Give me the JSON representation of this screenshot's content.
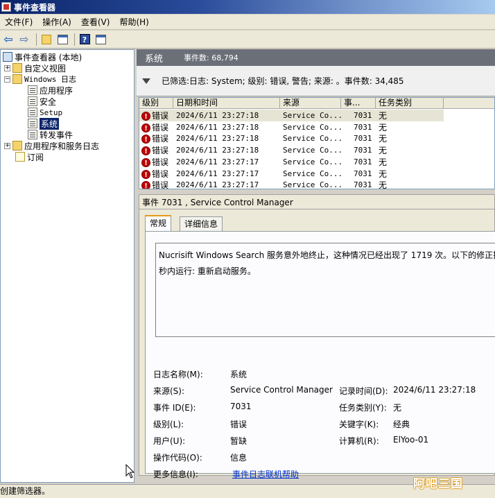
{
  "window": {
    "title": "事件查看器"
  },
  "menu": [
    "文件(F)",
    "操作(A)",
    "查看(V)",
    "帮助(H)"
  ],
  "tree": {
    "root": "事件查看器 (本地)",
    "custom_views": "自定义视图",
    "windows_logs": "Windows 日志",
    "logs": [
      "应用程序",
      "安全",
      "Setup",
      "系统",
      "转发事件"
    ],
    "app_service_logs": "应用程序和服务日志",
    "subscriptions": "订阅"
  },
  "header": {
    "title": "系统",
    "count": "事件数: 68,794"
  },
  "filter": {
    "text": "已筛选:日志: System; 级别: 错误, 警告; 来源: 。事件数: 34,485"
  },
  "table": {
    "columns": [
      "级别",
      "日期和时间",
      "来源",
      "事...",
      "任务类别"
    ],
    "rows": [
      {
        "level": "错误",
        "datetime": "2024/6/11 23:27:18",
        "source": "Service Co...",
        "id": "7031",
        "category": "无"
      },
      {
        "level": "错误",
        "datetime": "2024/6/11 23:27:18",
        "source": "Service Co...",
        "id": "7031",
        "category": "无"
      },
      {
        "level": "错误",
        "datetime": "2024/6/11 23:27:18",
        "source": "Service Co...",
        "id": "7031",
        "category": "无"
      },
      {
        "level": "错误",
        "datetime": "2024/6/11 23:27:18",
        "source": "Service Co...",
        "id": "7031",
        "category": "无"
      },
      {
        "level": "错误",
        "datetime": "2024/6/11 23:27:17",
        "source": "Service Co...",
        "id": "7031",
        "category": "无"
      },
      {
        "level": "错误",
        "datetime": "2024/6/11 23:27:17",
        "source": "Service Co...",
        "id": "7031",
        "category": "无"
      },
      {
        "level": "错误",
        "datetime": "2024/6/11 23:27:17",
        "source": "Service Co...",
        "id": "7031",
        "category": "无"
      }
    ]
  },
  "detail": {
    "title": "事件 7031 , Service Control Manager",
    "tabs": [
      "常规",
      "详细信息"
    ],
    "description_line1": "Nucrisift Windows Search 服务意外地终止，这种情况已经出现了 1719 次。以下的修正操作",
    "description_line2": "秒内运行: 重新启动服务。",
    "labels": {
      "log_name": "日志名称(M):",
      "source": "来源(S):",
      "event_id": "事件 ID(E):",
      "level": "级别(L):",
      "user": "用户(U):",
      "opcode": "操作代码(O):",
      "more_info": "更多信息(I):",
      "logged": "记录时间(D):",
      "task_category": "任务类别(Y):",
      "keywords": "关键字(K):",
      "computer": "计算机(R):"
    },
    "values": {
      "log_name": "系统",
      "source": "Service Control Manager",
      "event_id": "7031",
      "level": "错误",
      "user": "暂缺",
      "opcode": "信息",
      "more_info": "事件日志联机帮助",
      "logged": "2024/6/11 23:27:18",
      "task_category": "无",
      "keywords": "经典",
      "computer": "ElYoo-01"
    }
  },
  "status": {
    "text": "创建筛选器。"
  },
  "watermark": {
    "text": "阿吧三国"
  }
}
